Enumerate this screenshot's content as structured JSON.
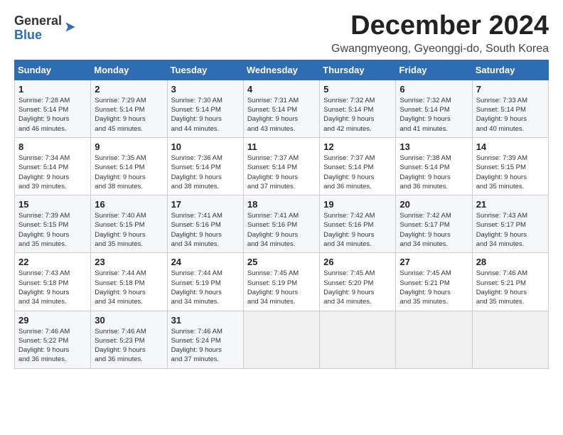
{
  "header": {
    "logo_general": "General",
    "logo_blue": "Blue",
    "month_title": "December 2024",
    "location": "Gwangmyeong, Gyeonggi-do, South Korea"
  },
  "calendar": {
    "weekdays": [
      "Sunday",
      "Monday",
      "Tuesday",
      "Wednesday",
      "Thursday",
      "Friday",
      "Saturday"
    ],
    "weeks": [
      [
        {
          "day": "1",
          "lines": [
            "Sunrise: 7:28 AM",
            "Sunset: 5:14 PM",
            "Daylight: 9 hours",
            "and 46 minutes."
          ]
        },
        {
          "day": "2",
          "lines": [
            "Sunrise: 7:29 AM",
            "Sunset: 5:14 PM",
            "Daylight: 9 hours",
            "and 45 minutes."
          ]
        },
        {
          "day": "3",
          "lines": [
            "Sunrise: 7:30 AM",
            "Sunset: 5:14 PM",
            "Daylight: 9 hours",
            "and 44 minutes."
          ]
        },
        {
          "day": "4",
          "lines": [
            "Sunrise: 7:31 AM",
            "Sunset: 5:14 PM",
            "Daylight: 9 hours",
            "and 43 minutes."
          ]
        },
        {
          "day": "5",
          "lines": [
            "Sunrise: 7:32 AM",
            "Sunset: 5:14 PM",
            "Daylight: 9 hours",
            "and 42 minutes."
          ]
        },
        {
          "day": "6",
          "lines": [
            "Sunrise: 7:32 AM",
            "Sunset: 5:14 PM",
            "Daylight: 9 hours",
            "and 41 minutes."
          ]
        },
        {
          "day": "7",
          "lines": [
            "Sunrise: 7:33 AM",
            "Sunset: 5:14 PM",
            "Daylight: 9 hours",
            "and 40 minutes."
          ]
        }
      ],
      [
        {
          "day": "8",
          "lines": [
            "Sunrise: 7:34 AM",
            "Sunset: 5:14 PM",
            "Daylight: 9 hours",
            "and 39 minutes."
          ]
        },
        {
          "day": "9",
          "lines": [
            "Sunrise: 7:35 AM",
            "Sunset: 5:14 PM",
            "Daylight: 9 hours",
            "and 38 minutes."
          ]
        },
        {
          "day": "10",
          "lines": [
            "Sunrise: 7:36 AM",
            "Sunset: 5:14 PM",
            "Daylight: 9 hours",
            "and 38 minutes."
          ]
        },
        {
          "day": "11",
          "lines": [
            "Sunrise: 7:37 AM",
            "Sunset: 5:14 PM",
            "Daylight: 9 hours",
            "and 37 minutes."
          ]
        },
        {
          "day": "12",
          "lines": [
            "Sunrise: 7:37 AM",
            "Sunset: 5:14 PM",
            "Daylight: 9 hours",
            "and 36 minutes."
          ]
        },
        {
          "day": "13",
          "lines": [
            "Sunrise: 7:38 AM",
            "Sunset: 5:14 PM",
            "Daylight: 9 hours",
            "and 36 minutes."
          ]
        },
        {
          "day": "14",
          "lines": [
            "Sunrise: 7:39 AM",
            "Sunset: 5:15 PM",
            "Daylight: 9 hours",
            "and 35 minutes."
          ]
        }
      ],
      [
        {
          "day": "15",
          "lines": [
            "Sunrise: 7:39 AM",
            "Sunset: 5:15 PM",
            "Daylight: 9 hours",
            "and 35 minutes."
          ]
        },
        {
          "day": "16",
          "lines": [
            "Sunrise: 7:40 AM",
            "Sunset: 5:15 PM",
            "Daylight: 9 hours",
            "and 35 minutes."
          ]
        },
        {
          "day": "17",
          "lines": [
            "Sunrise: 7:41 AM",
            "Sunset: 5:16 PM",
            "Daylight: 9 hours",
            "and 34 minutes."
          ]
        },
        {
          "day": "18",
          "lines": [
            "Sunrise: 7:41 AM",
            "Sunset: 5:16 PM",
            "Daylight: 9 hours",
            "and 34 minutes."
          ]
        },
        {
          "day": "19",
          "lines": [
            "Sunrise: 7:42 AM",
            "Sunset: 5:16 PM",
            "Daylight: 9 hours",
            "and 34 minutes."
          ]
        },
        {
          "day": "20",
          "lines": [
            "Sunrise: 7:42 AM",
            "Sunset: 5:17 PM",
            "Daylight: 9 hours",
            "and 34 minutes."
          ]
        },
        {
          "day": "21",
          "lines": [
            "Sunrise: 7:43 AM",
            "Sunset: 5:17 PM",
            "Daylight: 9 hours",
            "and 34 minutes."
          ]
        }
      ],
      [
        {
          "day": "22",
          "lines": [
            "Sunrise: 7:43 AM",
            "Sunset: 5:18 PM",
            "Daylight: 9 hours",
            "and 34 minutes."
          ]
        },
        {
          "day": "23",
          "lines": [
            "Sunrise: 7:44 AM",
            "Sunset: 5:18 PM",
            "Daylight: 9 hours",
            "and 34 minutes."
          ]
        },
        {
          "day": "24",
          "lines": [
            "Sunrise: 7:44 AM",
            "Sunset: 5:19 PM",
            "Daylight: 9 hours",
            "and 34 minutes."
          ]
        },
        {
          "day": "25",
          "lines": [
            "Sunrise: 7:45 AM",
            "Sunset: 5:19 PM",
            "Daylight: 9 hours",
            "and 34 minutes."
          ]
        },
        {
          "day": "26",
          "lines": [
            "Sunrise: 7:45 AM",
            "Sunset: 5:20 PM",
            "Daylight: 9 hours",
            "and 34 minutes."
          ]
        },
        {
          "day": "27",
          "lines": [
            "Sunrise: 7:45 AM",
            "Sunset: 5:21 PM",
            "Daylight: 9 hours",
            "and 35 minutes."
          ]
        },
        {
          "day": "28",
          "lines": [
            "Sunrise: 7:46 AM",
            "Sunset: 5:21 PM",
            "Daylight: 9 hours",
            "and 35 minutes."
          ]
        }
      ],
      [
        {
          "day": "29",
          "lines": [
            "Sunrise: 7:46 AM",
            "Sunset: 5:22 PM",
            "Daylight: 9 hours",
            "and 36 minutes."
          ]
        },
        {
          "day": "30",
          "lines": [
            "Sunrise: 7:46 AM",
            "Sunset: 5:23 PM",
            "Daylight: 9 hours",
            "and 36 minutes."
          ]
        },
        {
          "day": "31",
          "lines": [
            "Sunrise: 7:46 AM",
            "Sunset: 5:24 PM",
            "Daylight: 9 hours",
            "and 37 minutes."
          ]
        },
        {
          "day": "",
          "lines": []
        },
        {
          "day": "",
          "lines": []
        },
        {
          "day": "",
          "lines": []
        },
        {
          "day": "",
          "lines": []
        }
      ]
    ]
  }
}
